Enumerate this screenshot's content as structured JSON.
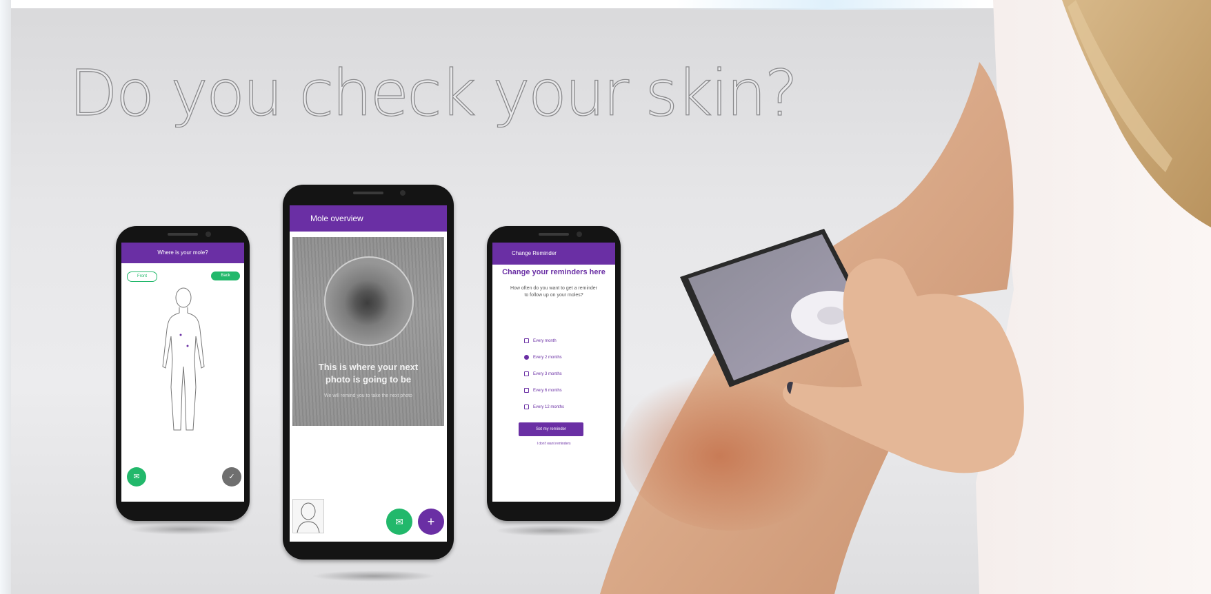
{
  "headline": "Do you check your skin?",
  "colors": {
    "brand_purple": "#6a2fa4",
    "action_green": "#22b86b",
    "background_grey": "#e6e6e8"
  },
  "phone_left": {
    "header": "Where is your mole?",
    "pill_left": "Front",
    "pill_right": "Back",
    "fab_left_icon": "chat-icon",
    "fab_right_icon": "check-icon"
  },
  "phone_center": {
    "header": "Mole overview",
    "photo_title": "This is where your next photo is going to be",
    "photo_subtitle": "We will remind you to take the next photo",
    "fab_green_icon": "chat-icon",
    "fab_purple_icon": "plus-icon"
  },
  "phone_right": {
    "header": "Change Reminder",
    "title": "Change your reminders here",
    "question": "How often do you want to get a reminder to follow up on your moles?",
    "options": [
      {
        "label": "Every month",
        "selected": false
      },
      {
        "label": "Every 2 months",
        "selected": true
      },
      {
        "label": "Every 3 months",
        "selected": false
      },
      {
        "label": "Every 6 months",
        "selected": false
      },
      {
        "label": "Every 12 months",
        "selected": false
      }
    ],
    "set_button": "Set my reminder",
    "skip_link": "I don't want reminders"
  }
}
